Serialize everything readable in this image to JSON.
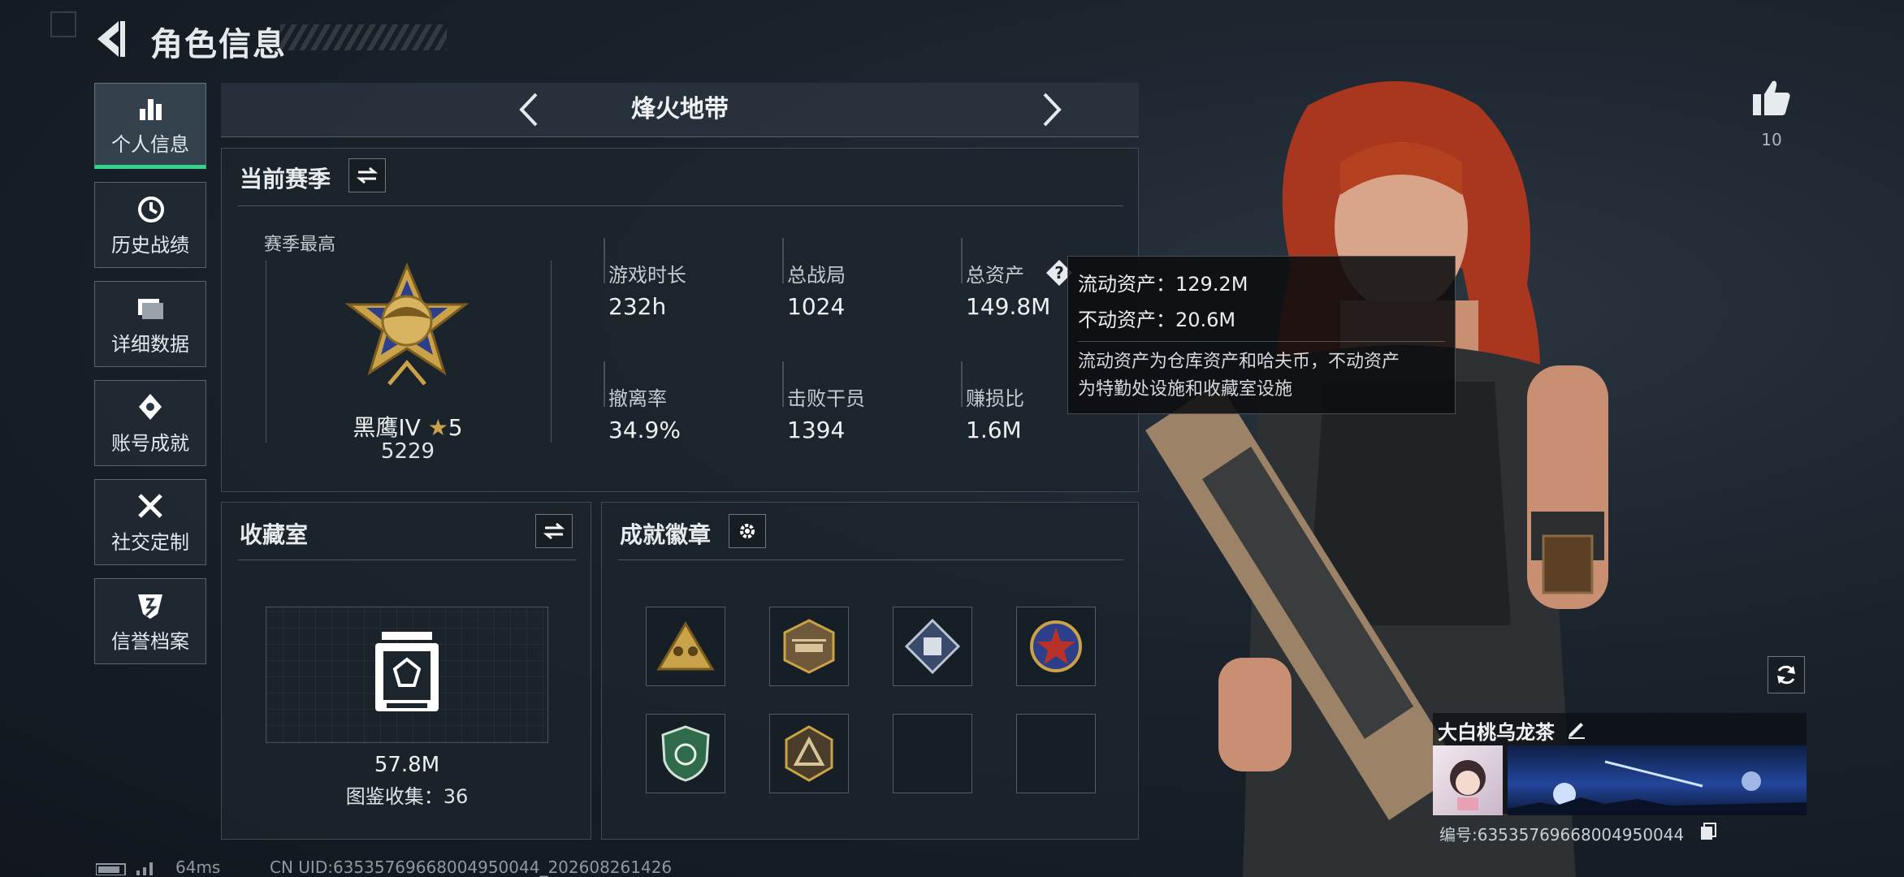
{
  "header": {
    "title": "角色信息"
  },
  "sidebar": {
    "items": [
      {
        "label": "个人信息",
        "icon": "bar-chart-icon",
        "active": true
      },
      {
        "label": "历史战绩",
        "icon": "history-icon"
      },
      {
        "label": "详细数据",
        "icon": "folder-icon"
      },
      {
        "label": "账号成就",
        "icon": "achievement-icon"
      },
      {
        "label": "社交定制",
        "icon": "tools-icon"
      },
      {
        "label": "信誉档案",
        "icon": "reputation-icon"
      }
    ]
  },
  "mode": {
    "label": "烽火地带"
  },
  "season": {
    "title": "当前赛季",
    "best_label": "赛季最高",
    "rank_name": "黑鹰IV",
    "rank_stars": "5",
    "rank_score": "5229",
    "stats": [
      {
        "label": "游戏时长",
        "value": "232h"
      },
      {
        "label": "总战局",
        "value": "1024"
      },
      {
        "label": "总资产",
        "value": "149.8M"
      },
      {
        "label": "撤离率",
        "value": "34.9%"
      },
      {
        "label": "击败干员",
        "value": "1394"
      },
      {
        "label": "赚损比",
        "value": "1.6M"
      }
    ]
  },
  "tooltip": {
    "liquid": "流动资产：129.2M",
    "fixed": "不动资产：20.6M",
    "desc_line1": "流动资产为仓库资产和哈夫币，不动资产",
    "desc_line2": "为特勤处设施和收藏室设施"
  },
  "collection": {
    "title": "收藏室",
    "value": "57.8M",
    "catalog": "图鉴收集：36"
  },
  "achievements": {
    "title": "成就徽章",
    "badges": [
      "triangle-soldiers-badge",
      "helicopter-badge",
      "diamond-crate-badge",
      "star-roundel-badge",
      "green-shield-badge",
      "triangle-emblem-badge",
      "empty",
      "empty"
    ]
  },
  "profile": {
    "likes": "10",
    "nickname": "大白桃乌龙茶",
    "id_text": "编号:6353576966800495004​4"
  },
  "footer": {
    "ping": "64ms",
    "uid": "CN UID:6353576966800495004​4_202608261426"
  },
  "colors": {
    "accent_green": "#33d38a",
    "gold": "#c9a24a"
  }
}
